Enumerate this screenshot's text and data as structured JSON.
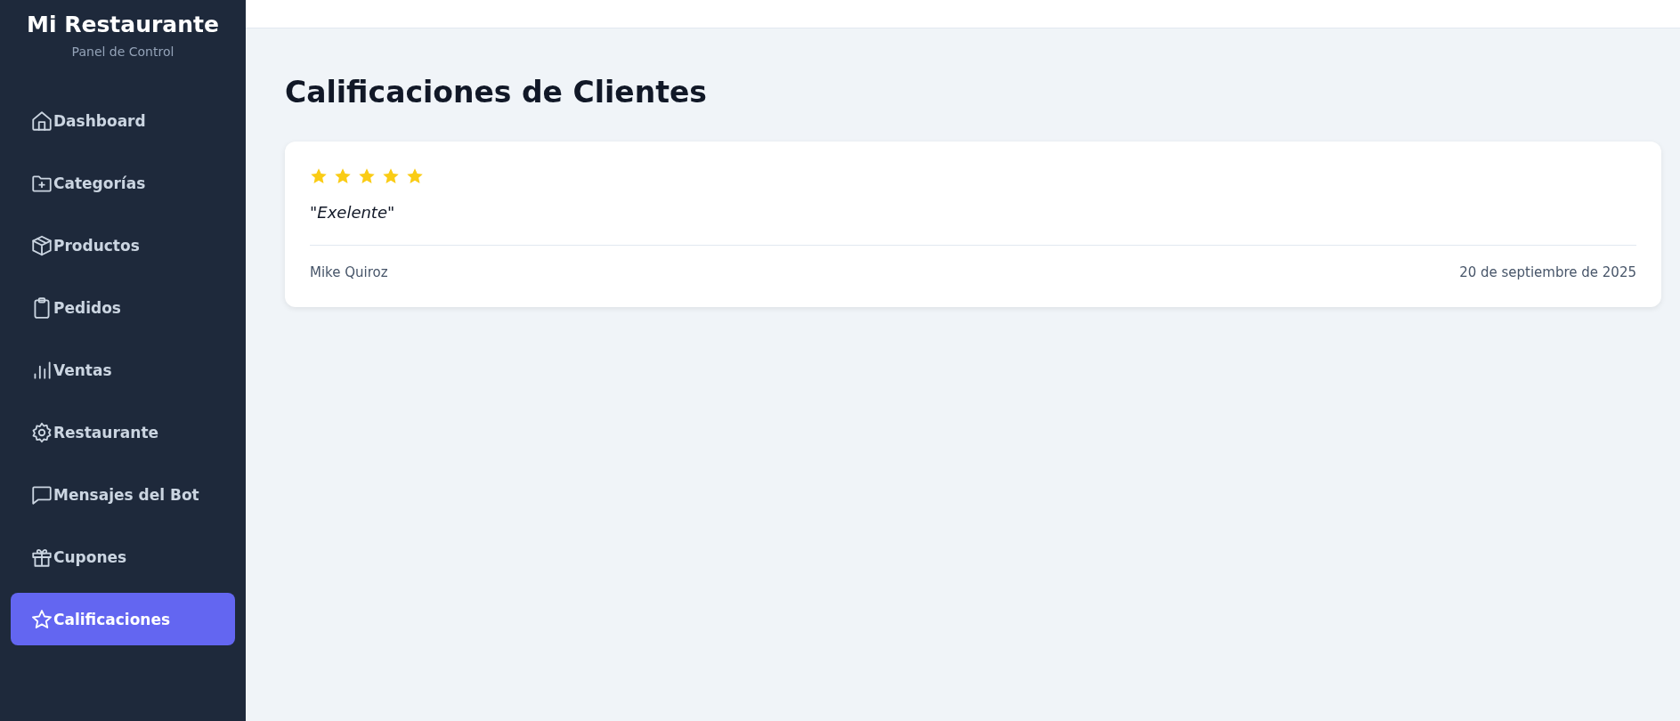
{
  "sidebar": {
    "title": "Mi Restaurante",
    "subtitle": "Panel de Control",
    "items": [
      {
        "label": "Dashboard",
        "selected": false
      },
      {
        "label": "Categorías",
        "selected": false
      },
      {
        "label": "Productos",
        "selected": false
      },
      {
        "label": "Pedidos",
        "selected": false
      },
      {
        "label": "Ventas",
        "selected": false
      },
      {
        "label": "Restaurante",
        "selected": false
      },
      {
        "label": "Mensajes del Bot",
        "selected": false
      },
      {
        "label": "Cupones",
        "selected": false
      },
      {
        "label": "Calificaciones",
        "selected": true
      }
    ]
  },
  "page": {
    "heading": "Calificaciones de Clientes",
    "reviews": [
      {
        "stars": 5,
        "comment": "\"Exelente\"",
        "author": "Mike Quiroz",
        "date": "20 de septiembre de 2025"
      }
    ]
  }
}
